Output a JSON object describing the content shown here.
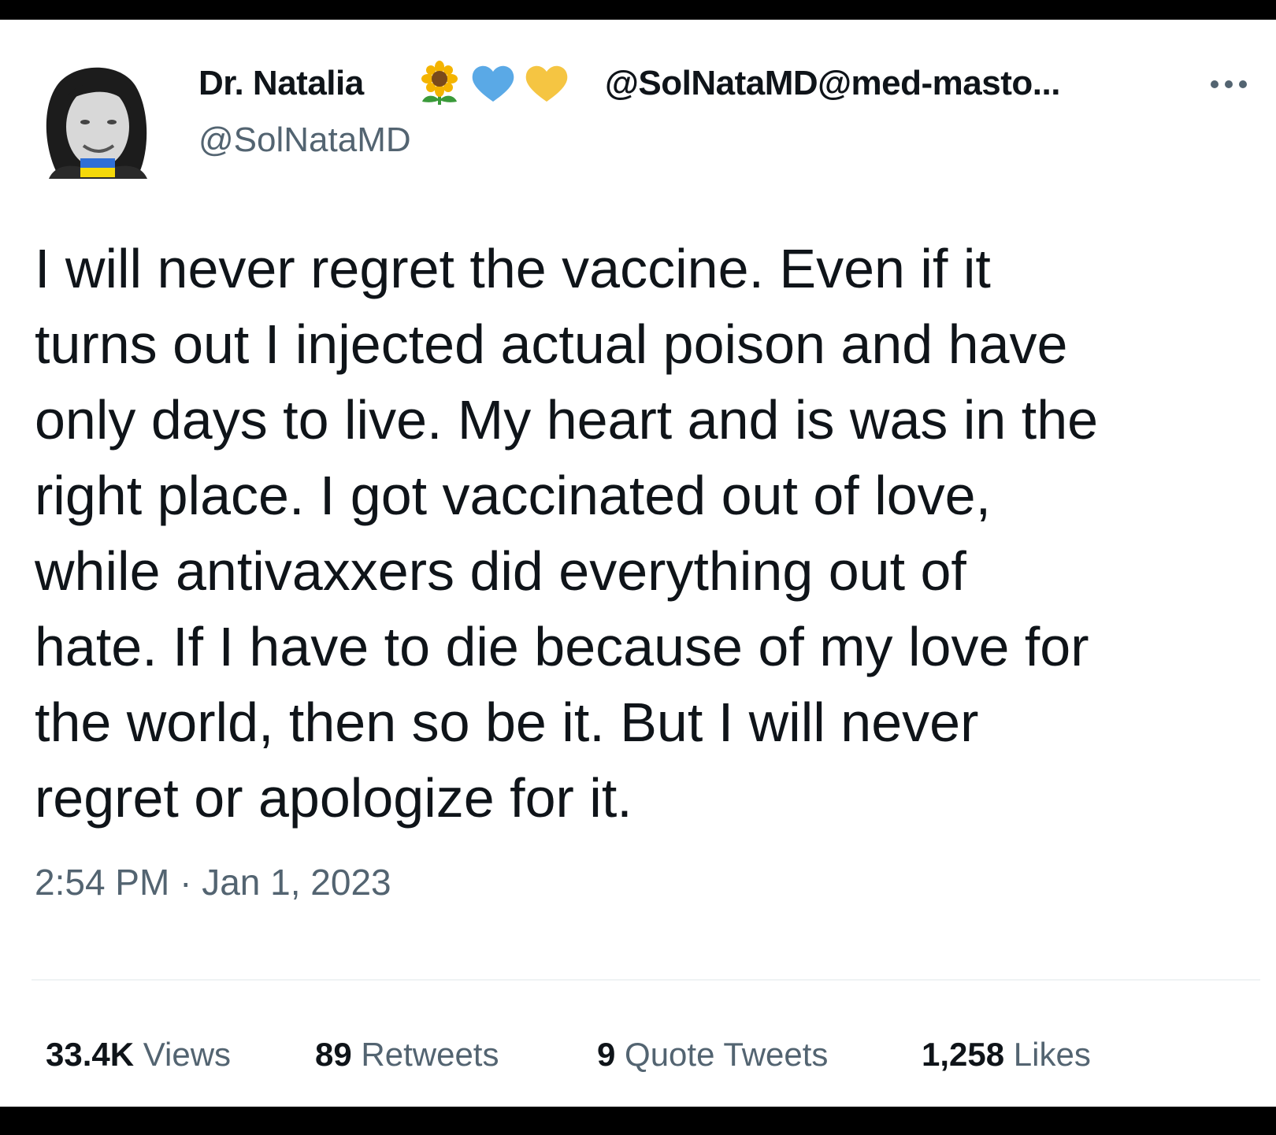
{
  "tweet": {
    "author": {
      "display_name": "Dr. Natalia",
      "name_emojis": [
        "sunflower-icon",
        "blue-heart-icon",
        "yellow-heart-icon"
      ],
      "mastodon_handle": "@SolNataMD@med-masto...",
      "username": "@SolNataMD"
    },
    "text_lines": [
      "I will never regret the vaccine. Even if it",
      "turns out I injected actual poison and have",
      "only days to live. My heart and is was in the",
      "right place. I got vaccinated out of love,",
      "while antivaxxers did everything out of",
      "hate. If I have to die because of my love for",
      "the world, then so be it. But I will never",
      "regret or apologize for it."
    ],
    "timestamp": "2:54 PM · Jan 1, 2023",
    "stats": {
      "views": {
        "value": "33.4K",
        "label": "Views"
      },
      "retweets": {
        "value": "89",
        "label": "Retweets"
      },
      "quote_tweets": {
        "value": "9",
        "label": "Quote Tweets"
      },
      "likes": {
        "value": "1,258",
        "label": "Likes"
      }
    }
  },
  "colors": {
    "text_primary": "#0f1419",
    "text_secondary": "#536471",
    "divider": "#eff3f4",
    "frame": "#000000",
    "blue_heart": "#5aa9e6",
    "yellow_heart": "#f5c542",
    "ukraine_blue": "#2f6fd6",
    "ukraine_yellow": "#f5d90a"
  }
}
